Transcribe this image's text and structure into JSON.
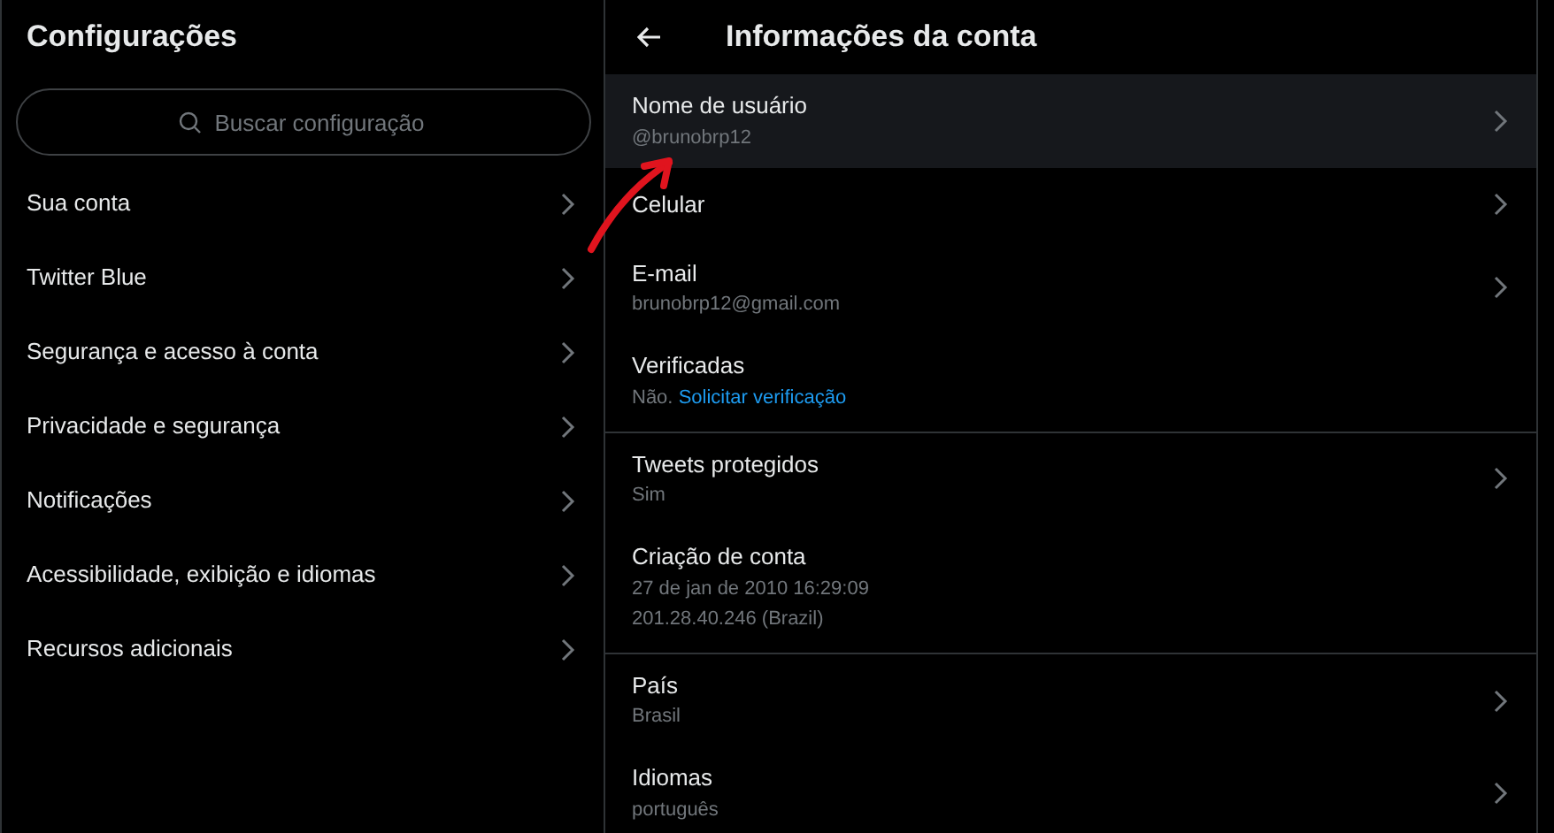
{
  "settings": {
    "title": "Configurações",
    "search": {
      "placeholder": "Buscar configuração"
    },
    "items": [
      {
        "label": "Sua conta"
      },
      {
        "label": "Twitter Blue"
      },
      {
        "label": "Segurança e acesso à conta"
      },
      {
        "label": "Privacidade e segurança"
      },
      {
        "label": "Notificações"
      },
      {
        "label": "Acessibilidade, exibição e idiomas"
      },
      {
        "label": "Recursos adicionais"
      }
    ]
  },
  "account": {
    "title": "Informações da conta",
    "sections": [
      [
        {
          "title": "Nome de usuário",
          "lines": [
            "@brunobrp12"
          ],
          "chevron": true,
          "selected": true
        },
        {
          "title": "Celular",
          "chevron": true,
          "selected": false
        },
        {
          "title": "E-mail",
          "lines": [
            "brunobrp12@gmail.com"
          ],
          "chevron": true,
          "selected": false
        },
        {
          "title": "Verificadas",
          "lines": [
            "Não."
          ],
          "link": "Solicitar verificação",
          "chevron": false,
          "selected": false
        }
      ],
      [
        {
          "title": "Tweets protegidos",
          "lines": [
            "Sim"
          ],
          "chevron": true,
          "selected": false
        },
        {
          "title": "Criação de conta",
          "lines": [
            "27 de jan de 2010 16:29:09",
            "201.28.40.246 (Brazil)"
          ],
          "chevron": false,
          "selected": false
        }
      ],
      [
        {
          "title": "País",
          "lines": [
            "Brasil"
          ],
          "chevron": true,
          "selected": false
        },
        {
          "title": "Idiomas",
          "lines": [
            "português"
          ],
          "chevron": true,
          "selected": false
        }
      ]
    ]
  },
  "annotation": {
    "kind": "arrow",
    "color": "#e0141e"
  }
}
